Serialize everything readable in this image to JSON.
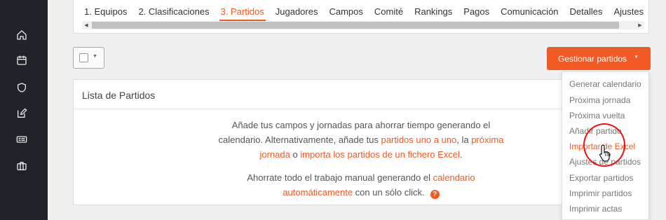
{
  "tabs": [
    {
      "label": "1. Equipos",
      "active": false
    },
    {
      "label": "2. Clasificaciones",
      "active": false
    },
    {
      "label": "3. Partidos",
      "active": true
    },
    {
      "label": "Jugadores",
      "active": false
    },
    {
      "label": "Campos",
      "active": false
    },
    {
      "label": "Comité",
      "active": false
    },
    {
      "label": "Rankings",
      "active": false
    },
    {
      "label": "Pagos",
      "active": false
    },
    {
      "label": "Comunicación",
      "active": false
    },
    {
      "label": "Detalles",
      "active": false
    },
    {
      "label": "Ajustes",
      "active": false
    }
  ],
  "sidebar_icons": [
    "home-icon",
    "calendar-icon",
    "shield-icon",
    "edit-icon",
    "id-card-icon",
    "briefcase-icon"
  ],
  "manage_button": {
    "label": "Gestionar partidos"
  },
  "panel": {
    "title": "Lista de Partidos",
    "p1_a": "Añade tus campos y jornadas para ahorrar tiempo generando el calendario. Alternativamente, añade tus ",
    "p1_link1": "partidos uno a uno",
    "p1_b": ", la ",
    "p1_link2": "próxima jornada",
    "p1_c": " o ",
    "p1_link3": "importa los partidos de un fichero Excel",
    "p1_d": ".",
    "p2_a": "Ahorrate todo el trabajo manual generando el ",
    "p2_link": "calendario automáticamente",
    "p2_b": " con un sólo click.",
    "help": "?"
  },
  "dropdown": [
    {
      "label": "Generar calendario",
      "highlight": false
    },
    {
      "label": "Próxima jornada",
      "highlight": false
    },
    {
      "label": "Próxima vuelta",
      "highlight": false
    },
    {
      "label": "Añadir partido",
      "highlight": false
    },
    {
      "label": "Importar de Excel",
      "highlight": true
    },
    {
      "label": "Ajustes de partidos",
      "highlight": false
    },
    {
      "label": "Exportar partidos",
      "highlight": false
    },
    {
      "label": "Imprimir partidos",
      "highlight": false
    },
    {
      "label": "Imprimir actas",
      "highlight": false
    }
  ],
  "colors": {
    "accent": "#f15a24",
    "sidebar": "#202428"
  }
}
